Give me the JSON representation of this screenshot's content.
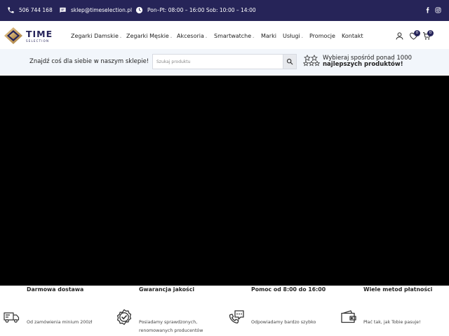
{
  "topbar": {
    "phone": "506 744 168",
    "email": "sklep@timeselection.pl",
    "hours": "Pon–Pt: 08:00 – 16:00 Sob: 10:00 – 14:00",
    "icons": [
      "phone-icon",
      "chat-mail-icon",
      "clock-icon",
      "facebook-icon",
      "instagram-icon"
    ]
  },
  "header": {
    "logo": {
      "main": "TIME",
      "sub": "SELECTION"
    },
    "nav": [
      {
        "label": "Zegarki Damskie",
        "dropdown": true
      },
      {
        "label": "Zegarki Męskie",
        "dropdown": true
      },
      {
        "label": "Akcesoria",
        "dropdown": true
      },
      {
        "label": "Smartwatche",
        "dropdown": true
      },
      {
        "label": "Marki",
        "dropdown": false
      },
      {
        "label": "Usługi",
        "dropdown": true
      },
      {
        "label": "Promocje",
        "dropdown": false
      },
      {
        "label": "Kontakt",
        "dropdown": false
      }
    ],
    "wishlist_count": "0",
    "cart_count": "0",
    "icons": [
      "user-icon",
      "heart-icon",
      "cart-icon"
    ]
  },
  "search_strip": {
    "label": "Znajdź coś dla siebie w naszym sklepie!",
    "placeholder": "Szukaj produktu",
    "value": "",
    "promo_line1": "Wybieraj spośród ponad 1000",
    "promo_line2": "najlepszych produktów!"
  },
  "hero": {
    "background": "#000000"
  },
  "features": [
    {
      "title": "Darmowa dostawa",
      "subtitle": "Od zamówienia minium 200zł",
      "icon": "truck-icon"
    },
    {
      "title": "Gwarancja jakości",
      "subtitle": "Posiadamy sprawdzonych,",
      "subtitle2": "renomowanych producentów",
      "icon": "check-badge-icon"
    },
    {
      "title": "Pomoc od 8:00 do 16:00",
      "subtitle": "Odpowiadamy bardzo szybko",
      "icon": "support-chat-icon"
    },
    {
      "title": "Wiele metod płatności",
      "subtitle": "Płać tak, jak Tobie pasuje!",
      "icon": "wallet-icon"
    }
  ],
  "colors": {
    "brand_navy": "#262458",
    "gold": "#c9a267",
    "strip_bg": "#f2f6fb"
  }
}
